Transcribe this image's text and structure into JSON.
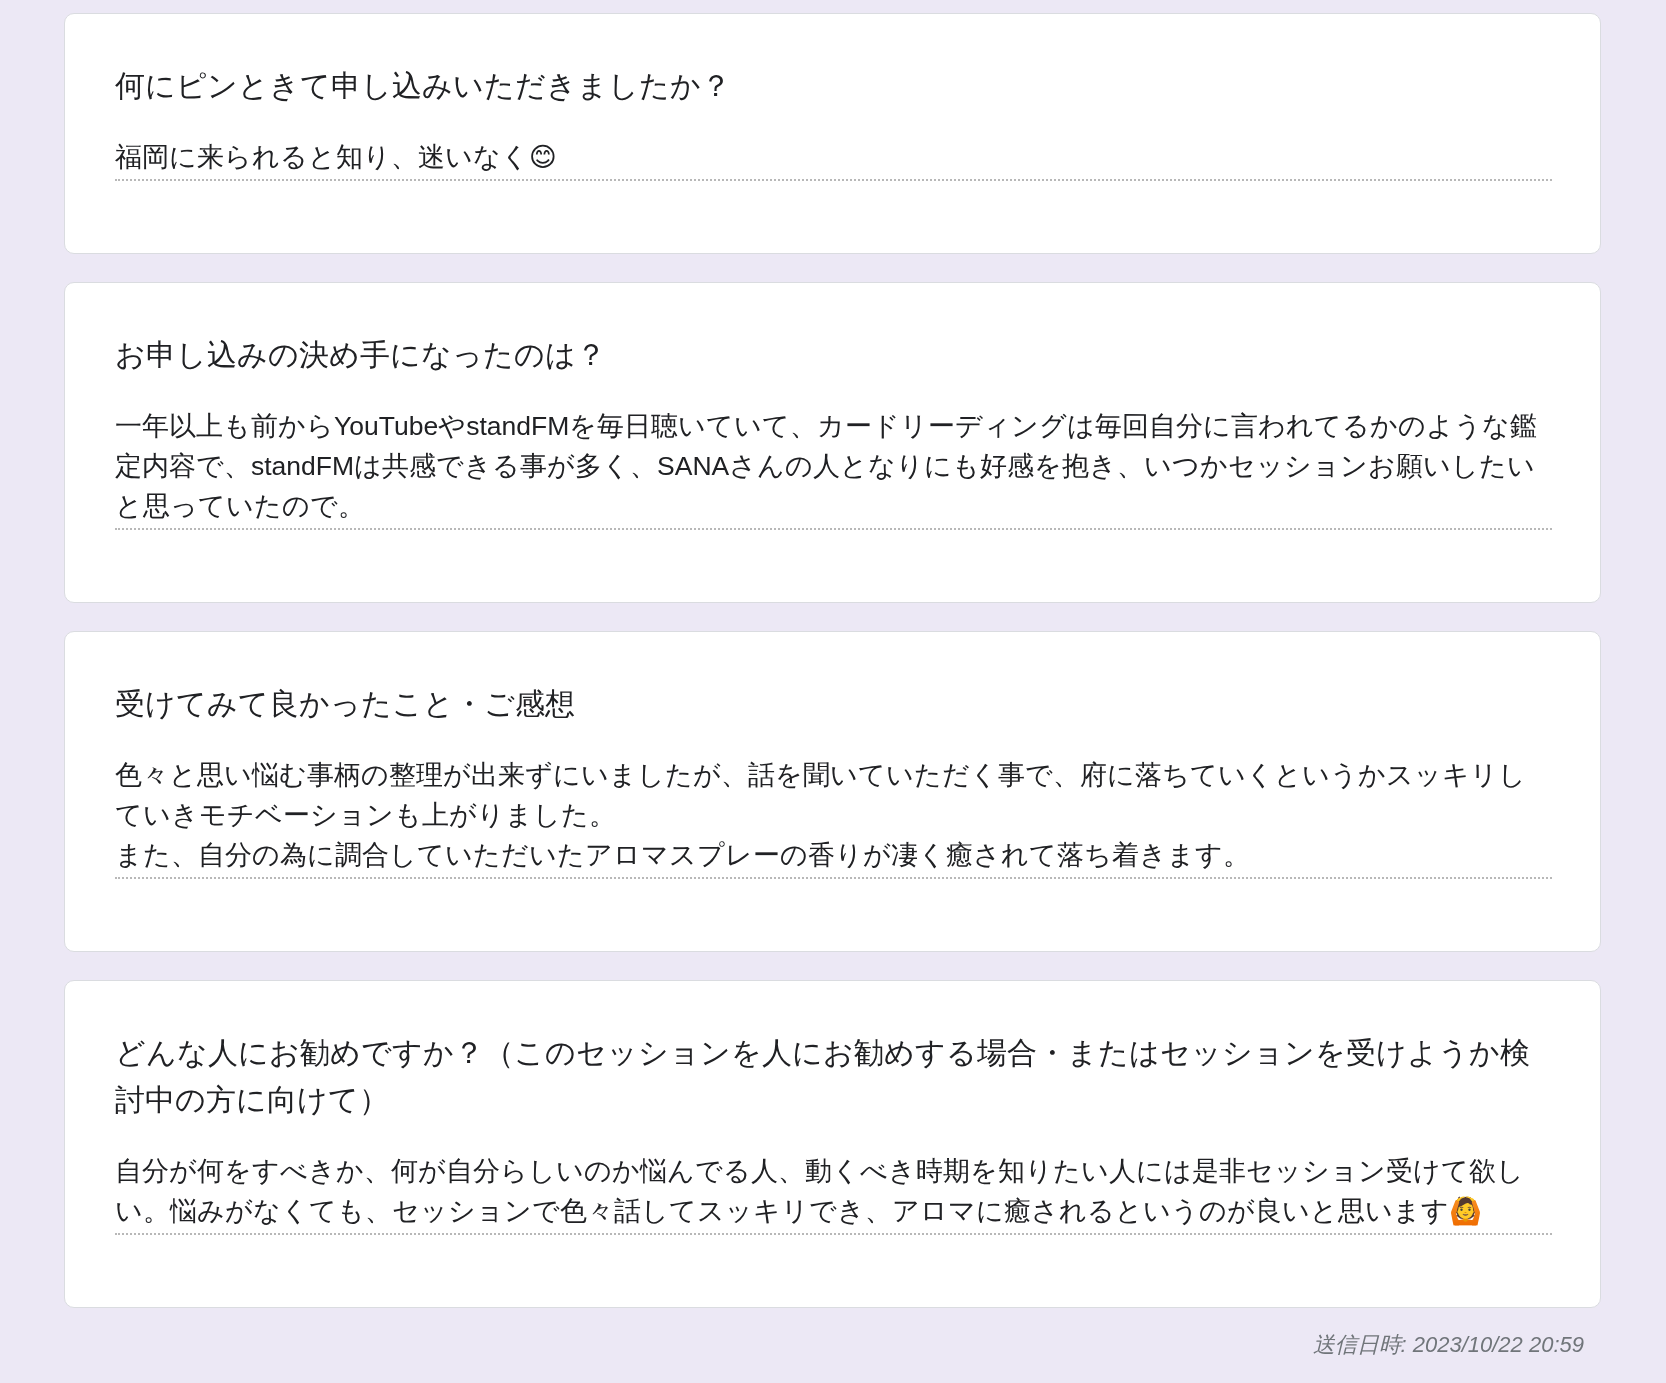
{
  "responses": [
    {
      "question": "何にピンときて申し込みいただきましたか？",
      "answer": [
        "福岡に来られると知り、迷いなく😊"
      ]
    },
    {
      "question": "お申し込みの決め手になったのは？",
      "answer": [
        "一年以上も前からYouTubeやstandFMを毎日聴いていて、カードリーディングは毎回自分に言われてるかのような鑑定内容で、standFMは共感できる事が多く、SANAさんの人となりにも好感を抱き、いつかセッションお願いしたいと思っていたので。"
      ]
    },
    {
      "question": "受けてみて良かったこと・ご感想",
      "answer": [
        "色々と思い悩む事柄の整理が出来ずにいましたが、話を聞いていただく事で、府に落ちていくというかスッキリしていきモチベーションも上がりました。",
        "また、自分の為に調合していただいたアロマスプレーの香りが凄く癒されて落ち着きます。"
      ]
    },
    {
      "question": "どんな人にお勧めですか？（このセッションを人にお勧めする場合・またはセッションを受けようか検討中の方に向けて）",
      "answer": [
        "自分が何をすべきか、何が自分らしいのか悩んでる人、動くべき時期を知りたい人には是非セッション受けて欲しい。悩みがなくても、セッションで色々話してスッキリでき、アロマに癒されるというのが良いと思います🙆"
      ]
    }
  ],
  "timestamp": "送信日時: 2023/10/22 20:59"
}
